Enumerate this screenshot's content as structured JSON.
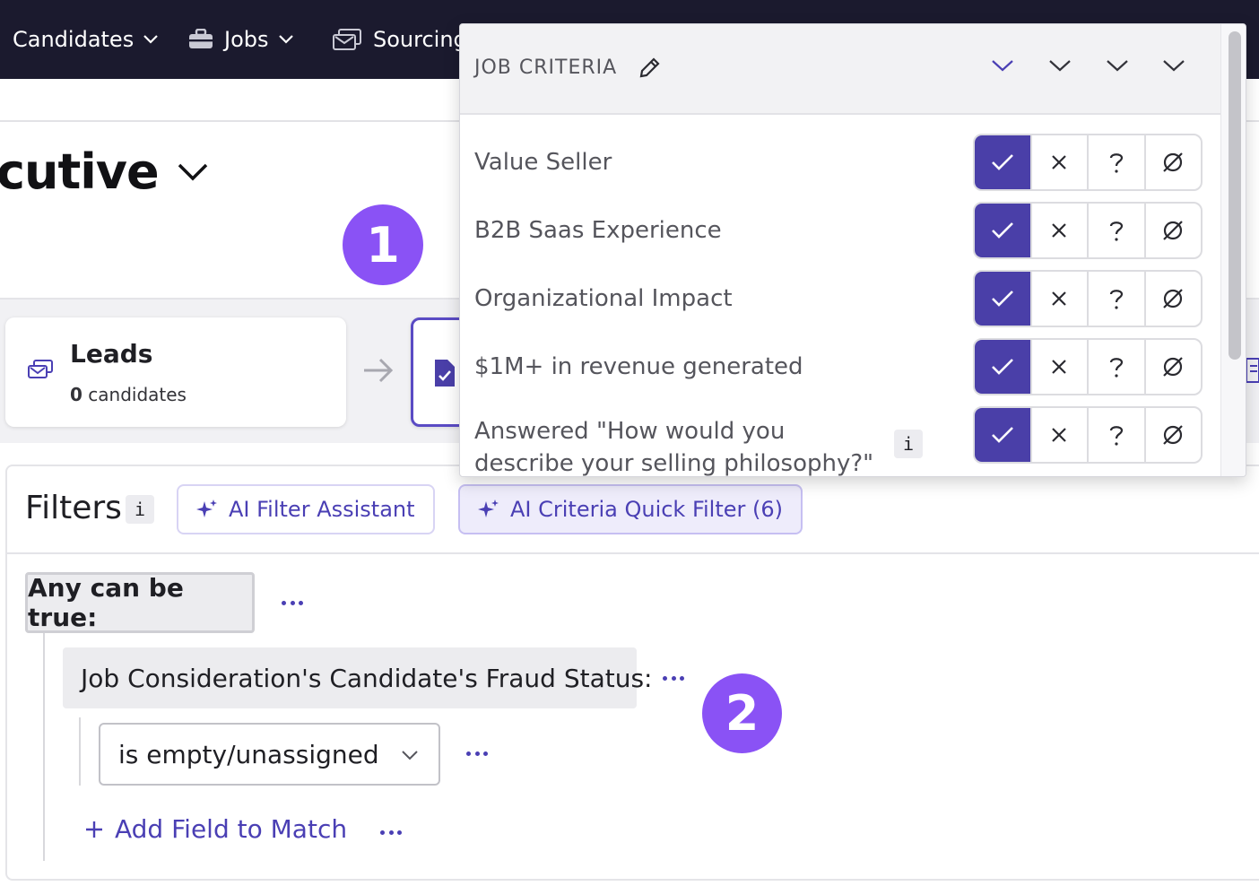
{
  "nav": {
    "items": [
      {
        "label": "Candidates",
        "icon": "chevron-down-icon"
      },
      {
        "label": "Jobs",
        "icon": "briefcase-icon"
      },
      {
        "label": "Sourcing",
        "icon": "sourcing-inbox-icon"
      }
    ]
  },
  "job": {
    "title": "cutive"
  },
  "badges": {
    "one": "1",
    "two": "2"
  },
  "pipeline": {
    "leads": {
      "title": "Leads",
      "count": "0",
      "count_suffix": " candidates"
    }
  },
  "filters": {
    "title": "Filters",
    "info": "i",
    "ai_filter_assistant": "AI Filter Assistant",
    "ai_criteria_quick_filter": "AI Criteria Quick Filter (6)",
    "group_label": "Any can be true:",
    "condition_field": "Job Consideration's Candidate's Fraud Status:",
    "condition_operator": "is empty/unassigned",
    "add_field": "Add Field to Match"
  },
  "job_criteria": {
    "title": "JOB CRITERIA",
    "criteria": [
      {
        "label": "Value Seller",
        "selected": "met"
      },
      {
        "label": "B2B Saas Experience",
        "selected": "met"
      },
      {
        "label": "Organizational Impact",
        "selected": "met"
      },
      {
        "label": "$1M+ in revenue generated",
        "selected": "met"
      },
      {
        "label": "Answered \"How would you describe your selling philosophy?\"",
        "selected": "met",
        "info": "i"
      }
    ],
    "options": [
      "met",
      "not-met",
      "unknown",
      "not-applicable"
    ]
  },
  "colors": {
    "nav_bg": "#1b1a2e",
    "accent": "#4a3fa8",
    "link": "#4a3fb4",
    "badge": "#8a52f5"
  }
}
